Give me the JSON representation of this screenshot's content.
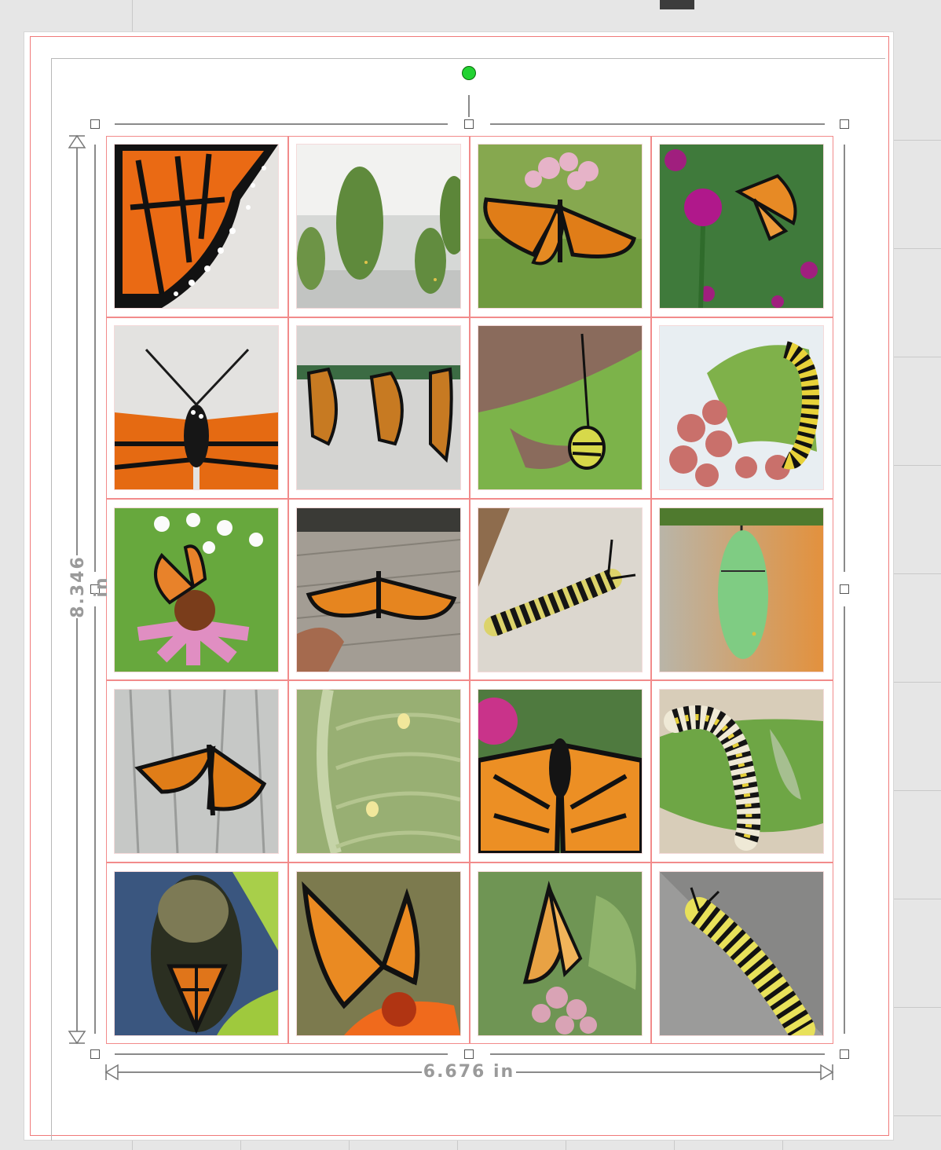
{
  "dimensions": {
    "height_label": "8.346 in",
    "width_label": "6.676 in"
  },
  "grid": {
    "rows": 5,
    "columns": 4,
    "photos": [
      {
        "row": 1,
        "col": 1,
        "subject": "monarch wing closeup"
      },
      {
        "row": 1,
        "col": 2,
        "subject": "chrysalises hanging"
      },
      {
        "row": 1,
        "col": 3,
        "subject": "monarch on milkweed flowers"
      },
      {
        "row": 1,
        "col": 4,
        "subject": "monarch on globe amaranth"
      },
      {
        "row": 2,
        "col": 1,
        "subject": "monarch body with antennae"
      },
      {
        "row": 2,
        "col": 2,
        "subject": "three newly emerged monarchs"
      },
      {
        "row": 2,
        "col": 3,
        "subject": "small caterpillar on leaf"
      },
      {
        "row": 2,
        "col": 4,
        "subject": "caterpillar on milkweed buds"
      },
      {
        "row": 3,
        "col": 1,
        "subject": "monarch on coneflower"
      },
      {
        "row": 3,
        "col": 2,
        "subject": "monarch on hand over deck"
      },
      {
        "row": 3,
        "col": 3,
        "subject": "caterpillar on paper"
      },
      {
        "row": 3,
        "col": 4,
        "subject": "green chrysalis"
      },
      {
        "row": 4,
        "col": 1,
        "subject": "monarch on wood"
      },
      {
        "row": 4,
        "col": 2,
        "subject": "eggs on milkweed leaf"
      },
      {
        "row": 4,
        "col": 3,
        "subject": "monarch wings spread closeup"
      },
      {
        "row": 4,
        "col": 4,
        "subject": "caterpillar on leaf"
      },
      {
        "row": 5,
        "col": 1,
        "subject": "dark chrysalis before emergence"
      },
      {
        "row": 5,
        "col": 2,
        "subject": "monarch on zinnia"
      },
      {
        "row": 5,
        "col": 3,
        "subject": "monarch on milkweed cluster"
      },
      {
        "row": 5,
        "col": 4,
        "subject": "caterpillar closeup"
      }
    ]
  },
  "colors": {
    "margin_guide": "#f07a7a",
    "rotation_handle": "#22d332",
    "monarch_orange": "#e8721c",
    "leaf_green": "#6aa84f"
  }
}
